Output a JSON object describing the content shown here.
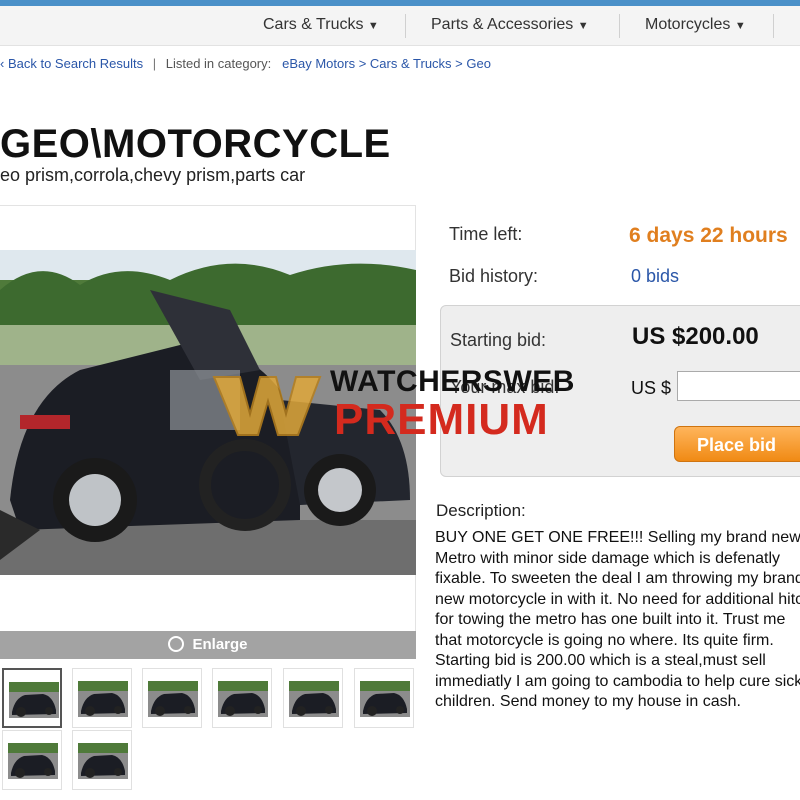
{
  "nav": {
    "items": [
      {
        "label": "Cars & Trucks"
      },
      {
        "label": "Parts & Accessories"
      },
      {
        "label": "Motorcycles"
      }
    ]
  },
  "breadcrumb": {
    "back": "Back to Search Results",
    "listed": "Listed in category:",
    "path": [
      "eBay Motors",
      "Cars & Trucks",
      "Geo"
    ],
    "separator": ">"
  },
  "listing": {
    "title": "GEO\\MOTORCYCLE",
    "subtitle": "eo prism,corrola,chevy prism,parts car"
  },
  "gallery": {
    "enlarge_label": "Enlarge",
    "thumbnail_count": 8
  },
  "details": {
    "time_left_label": "Time left:",
    "time_left_value": "6 days 22 hours",
    "bid_history_label": "Bid history:",
    "bid_history_value": "0 bids",
    "starting_bid_label": "Starting bid:",
    "starting_bid_value": "US $200.00",
    "max_bid_label": "Your max bid:",
    "currency_prefix": "US $",
    "bid_input_value": "",
    "place_bid_label": "Place bid"
  },
  "description": {
    "label": "Description:",
    "text": "BUY ONE GET ONE FREE!!! Selling my brand new Metro with minor side damage which is defenatly fixable. To sweeten the deal I am throwing my brand new motorcycle in with it. No need for additional hitch for towing the metro has one built into it. Trust me that motorcycle is going no where. Its quite firm.  Starting bid is 200.00 which is a steal,must sell immediatly I am going to cambodia to help cure sick children. Send money to my house in cash."
  },
  "watermark": {
    "line1": "WATCHERSWEB",
    "line2": "PREMIUM"
  },
  "colors": {
    "accent_blue": "#2a56a8",
    "time_orange": "#e07f1f",
    "button_orange": "#f08a14",
    "watermark_red": "#d42a1e"
  }
}
